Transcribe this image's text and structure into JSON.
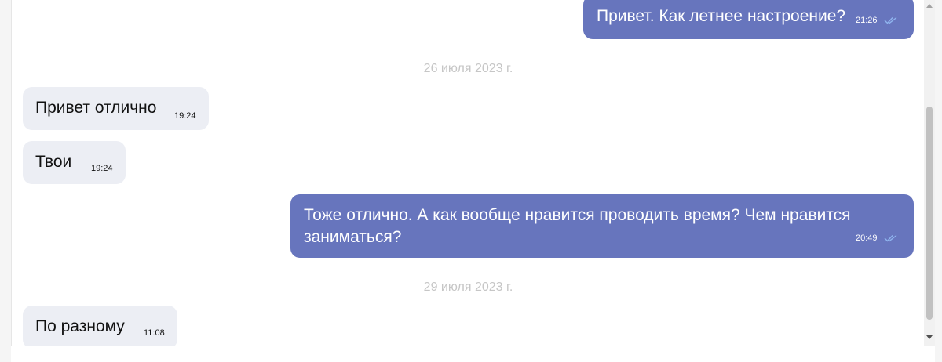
{
  "colors": {
    "outgoing_bubble": "#6775bd",
    "incoming_bubble": "#eceef4",
    "date_separator": "#c6c6c6",
    "read_checks": "#8fb4ee"
  },
  "messages": [
    {
      "direction": "outgoing",
      "text": "Привет. Как летнее настроение?",
      "time": "21:26",
      "status_icon": "double-check-icon"
    },
    {
      "type": "date",
      "text": "26 июля 2023 г."
    },
    {
      "direction": "incoming",
      "text": "Привет отлично",
      "time": "19:24"
    },
    {
      "direction": "incoming",
      "text": "Твои",
      "time": "19:24"
    },
    {
      "direction": "outgoing",
      "text_line1": "Тоже отлично. А как вообще нравится проводить время? Чем нравится",
      "text_line2": "заниматься?",
      "time": "20:49",
      "status_icon": "double-check-icon"
    },
    {
      "type": "date",
      "text": "29 июля 2023 г."
    },
    {
      "direction": "incoming",
      "text": "По разному",
      "time": "11:08"
    }
  ]
}
